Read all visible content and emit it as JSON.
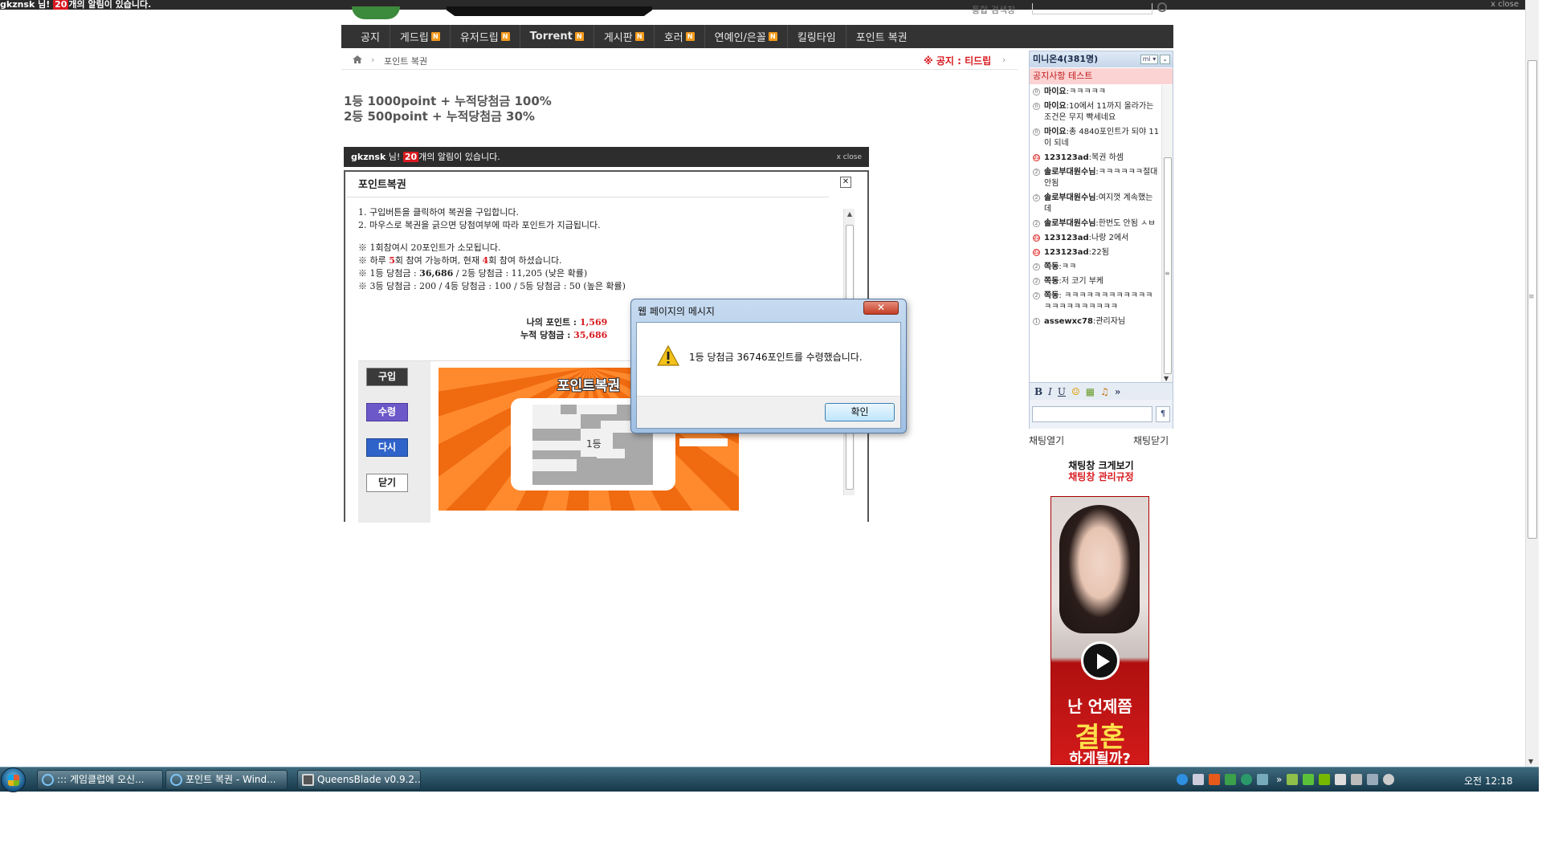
{
  "top_notification": {
    "user": "gkznsk",
    "suffix": " 님! ",
    "count": "20",
    "message": "개의 알림이 있습니다.",
    "close": "x close"
  },
  "header": {
    "login_label": "통합 검색창"
  },
  "nav": {
    "items": [
      {
        "label": "공지",
        "badge": ""
      },
      {
        "label": "게드립",
        "badge": "N"
      },
      {
        "label": "유저드립",
        "badge": "N"
      },
      {
        "label": "Torrent",
        "badge": "N"
      },
      {
        "label": "게시판",
        "badge": "N"
      },
      {
        "label": "호러",
        "badge": "N"
      },
      {
        "label": "연예인/은꼴",
        "badge": "N"
      },
      {
        "label": "킬링타임",
        "badge": ""
      },
      {
        "label": "포인트 복권",
        "badge": ""
      }
    ]
  },
  "breadcrumb": {
    "separator": "›",
    "page": "포인트 복권",
    "notice": "※ 공지 : 티드립",
    "notice_arrow": "›"
  },
  "prizes": {
    "line1": "1등  1000point + 누적당첨금 100%",
    "line2": "2등  500point + 누적당첨금 30%"
  },
  "inner_alert": {
    "user": "gkznsk",
    "suffix": " 님! ",
    "count": "20",
    "message": "개의 알림이 있습니다.",
    "close": "x close"
  },
  "lotto": {
    "title": "포인트복권",
    "close": "✕",
    "instructions": [
      "1. 구입버튼을 클릭하여 복권을 구입합니다.",
      "2. 마우스로 복권을 긁으면 당첨여부에 따라 포인트가 지급됩니다."
    ],
    "rule_cost": "※ 1회참여시 20포인트가 소모됩니다.",
    "rule_daily_a": "※ 하루 ",
    "rule_daily_n1": "5",
    "rule_daily_b": "회 참여 가능하며, 현재 ",
    "rule_daily_n2": "4",
    "rule_daily_c": "회 참여 하셨습니다.",
    "rule_prize_a": "※ 1등 당첨금 : ",
    "rule_prize_v1": "36,686",
    "rule_prize_b": " / 2등 당첨금 : 11,205 (낮은 확률)",
    "rule_prize_low": "※ 3등 당첨금 : 200 / 4등 당첨금 : 100 / 5등 당첨금 : 50 (높은 확률)",
    "my_points_label": "나의 포인트 : ",
    "my_points_value": "1,569",
    "accumulated_label": "누적 당첨금 : ",
    "accumulated_value": "35,686",
    "buttons": {
      "buy": "구입",
      "receive": "수령",
      "again": "다시",
      "close": "닫기"
    },
    "ticket_title": "포인트복권",
    "scratch_result": "1등"
  },
  "dialog": {
    "title": "웹 페이지의 메시지",
    "close": "✕",
    "message": "1등 당첨금 36746포인트를 수령했습니다.",
    "ok": "확인"
  },
  "chat": {
    "header": "미니온4(381명)",
    "header_btn1": "mi ▾",
    "header_btn2": "⌄",
    "notice": "공지사항 테스트",
    "messages": [
      {
        "level": "0",
        "red": false,
        "user": "마이요",
        "text": ":ㅋㅋㅋㅋㅋ"
      },
      {
        "level": "0",
        "red": false,
        "user": "마이요",
        "text": ":10에서 11까지 올라가는 조건은 무지 빡세네요"
      },
      {
        "level": "0",
        "red": false,
        "user": "마이요",
        "text": ":총 4840포인트가 되야 11이 되네"
      },
      {
        "level": "22",
        "red": true,
        "user": "123123ad",
        "text": ":복권 하셈"
      },
      {
        "level": "2",
        "red": false,
        "user": "솔로부대원수님",
        "text": ":ㅋㅋㅋㅋㅋㅋ절대안됨"
      },
      {
        "level": "2",
        "red": false,
        "user": "솔로부대원수님",
        "text": ":여지껏 계속했는데"
      },
      {
        "level": "2",
        "red": false,
        "user": "솔로부대원수님",
        "text": ":한번도 안됨 ㅅㅂ"
      },
      {
        "level": "22",
        "red": true,
        "user": "123123ad",
        "text": ":나랑 2에서"
      },
      {
        "level": "22",
        "red": true,
        "user": "123123ad",
        "text": ":22됨"
      },
      {
        "level": "2",
        "red": false,
        "user": "쪽동",
        "text": ":ㅋㅋ"
      },
      {
        "level": "2",
        "red": false,
        "user": "쪽동",
        "text": ":저 코기 부케"
      },
      {
        "level": "2",
        "red": false,
        "user": "쪽동",
        "text": ": ㅋㅋㅋㅋㅋㅋㅋㅋㅋㅋㅋㅋㅋㅋㅋㅋㅋㅋㅋㅋㅋㅋ"
      },
      {
        "level": "1",
        "red": false,
        "user": "assewxc78",
        "text": ":관리자님"
      }
    ],
    "toolbar": [
      "B",
      "I",
      "U",
      "☺",
      "▦",
      "♫",
      "»"
    ],
    "send": "¶",
    "open_link": "채팅열기",
    "close_link": "채팅닫기",
    "enlarge_link": "채팅창 크게보기",
    "rules_link": "채팅창 관리규정"
  },
  "ad": {
    "line1": "난 언제쯤",
    "line2": "결혼",
    "line3": "하게될까?"
  },
  "taskbar": {
    "tasks": [
      {
        "label": "::: 게임클럽에 오신..."
      },
      {
        "label": "포인트 복권 - Wind..."
      },
      {
        "label": "QueensBlade v0.9.2..."
      }
    ],
    "tray_expand": "»",
    "clock": "오전 12:18"
  },
  "colors": {
    "nav_bg": "#333333",
    "accent_red": "#d8191f",
    "badge_orange": "#f39a1b",
    "ticket_orange": "#f06a10"
  }
}
